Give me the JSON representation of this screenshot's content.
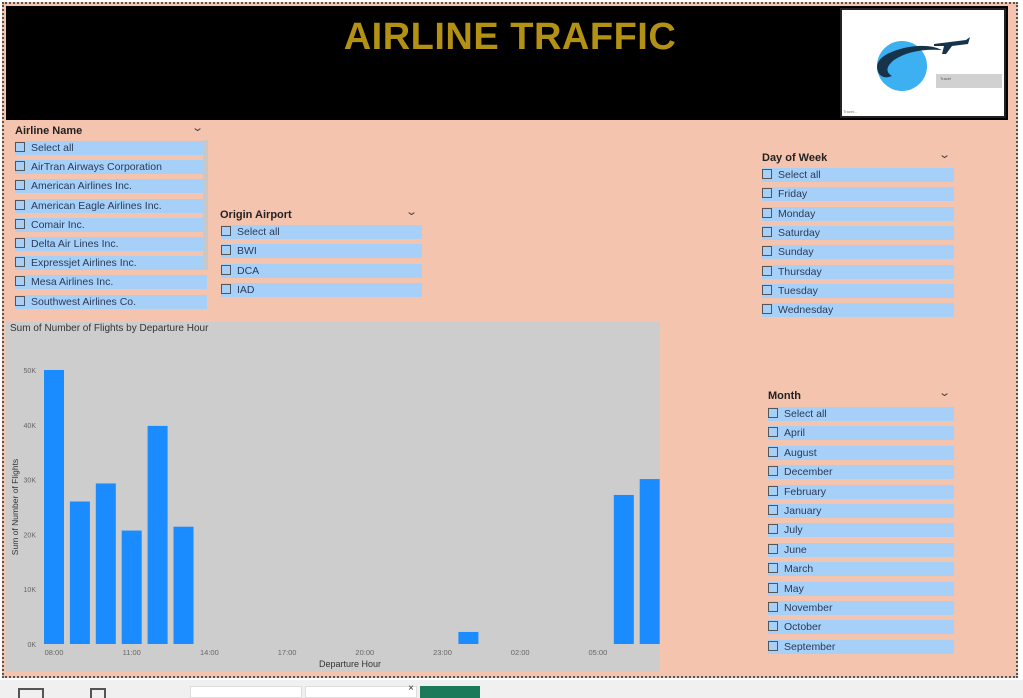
{
  "header": {
    "title": "AIRLINE TRAFFIC",
    "logo_caption": "Travel..."
  },
  "colors": {
    "header_bg": "#000000",
    "title": "#b39114",
    "canvas_bg": "#f5c4ae",
    "slicer_item_bg": "#a7d0f8",
    "bar": "#1a8cff",
    "chart_bg": "#cdcdcd"
  },
  "slicers": {
    "airline": {
      "title": "Airline Name",
      "items": [
        "Select all",
        "AirTran Airways Corporation",
        "American Airlines Inc.",
        "American Eagle Airlines Inc.",
        "Comair Inc.",
        "Delta Air Lines Inc.",
        "Expressjet Airlines Inc.",
        "Mesa Airlines Inc.",
        "Southwest Airlines Co."
      ]
    },
    "origin": {
      "title": "Origin Airport",
      "items": [
        "Select all",
        "BWI",
        "DCA",
        "IAD"
      ]
    },
    "day": {
      "title": "Day of Week",
      "items": [
        "Select all",
        "Friday",
        "Monday",
        "Saturday",
        "Sunday",
        "Thursday",
        "Tuesday",
        "Wednesday"
      ]
    },
    "month": {
      "title": "Month",
      "items": [
        "Select all",
        "April",
        "August",
        "December",
        "February",
        "January",
        "July",
        "June",
        "March",
        "May",
        "November",
        "October",
        "September"
      ]
    }
  },
  "chart_data": {
    "type": "bar",
    "title": "Sum of Number of Flights by Departure Hour",
    "xlabel": "Departure Hour",
    "ylabel": "Sum of Number of Flights",
    "ylim": [
      0,
      50000
    ],
    "yticks": [
      "0K",
      "10K",
      "20K",
      "30K",
      "40K",
      "50K"
    ],
    "xticks": [
      "08:00",
      "11:00",
      "14:00",
      "17:00",
      "20:00",
      "23:00",
      "02:00",
      "05:00"
    ],
    "x": [
      "08:00",
      "09:00",
      "10:00",
      "11:00",
      "12:00",
      "13:00",
      "14:00",
      "15:00",
      "16:00",
      "17:00",
      "18:00",
      "19:00",
      "20:00",
      "21:00",
      "22:00",
      "23:00",
      "00:00",
      "01:00",
      "02:00",
      "03:00",
      "04:00",
      "05:00",
      "06:00",
      "07:00"
    ],
    "values": [
      50000,
      26000,
      29300,
      20700,
      39800,
      21400,
      0,
      0,
      0,
      0,
      0,
      0,
      0,
      0,
      0,
      0,
      2200,
      0,
      0,
      0,
      0,
      0,
      27200,
      30100
    ],
    "grid": false
  }
}
